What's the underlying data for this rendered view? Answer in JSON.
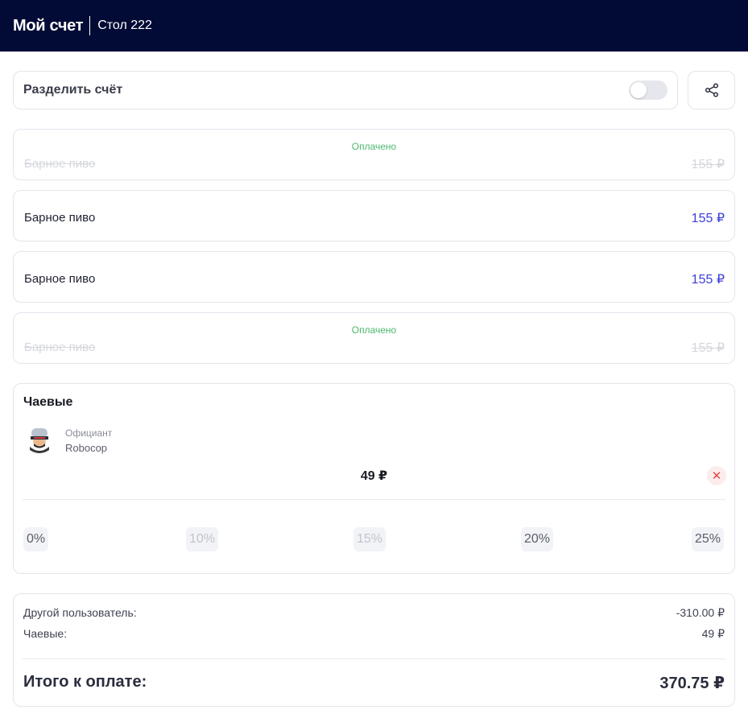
{
  "header": {
    "title": "Мой счет",
    "table": "Стол 222"
  },
  "split": {
    "label": "Разделить счёт",
    "enabled": false
  },
  "items": [
    {
      "name": "Барное пиво",
      "price": "155 ₽",
      "paid": true,
      "status": "Оплачено"
    },
    {
      "name": "Барное пиво",
      "price": "155 ₽",
      "paid": false,
      "status": ""
    },
    {
      "name": "Барное пиво",
      "price": "155 ₽",
      "paid": false,
      "status": ""
    },
    {
      "name": "Барное пиво",
      "price": "155 ₽",
      "paid": true,
      "status": "Оплачено"
    }
  ],
  "tips": {
    "title": "Чаевые",
    "waiter_role": "Официант",
    "waiter_name": "Robocop",
    "amount": "49 ₽",
    "options": [
      "0%",
      "10%",
      "15%",
      "20%",
      "25%"
    ]
  },
  "summary": {
    "other_user_label": "Другой пользователь:",
    "other_user_value": "-310.00 ₽",
    "tips_label": "Чаевые:",
    "tips_value": "49 ₽",
    "total_label": "Итого к оплате:",
    "total_value": "370.75 ₽"
  },
  "colors": {
    "header_bg": "#020b35",
    "price": "#3b3fd8",
    "paid_status": "#4cb86e",
    "clear": "#e04848"
  }
}
